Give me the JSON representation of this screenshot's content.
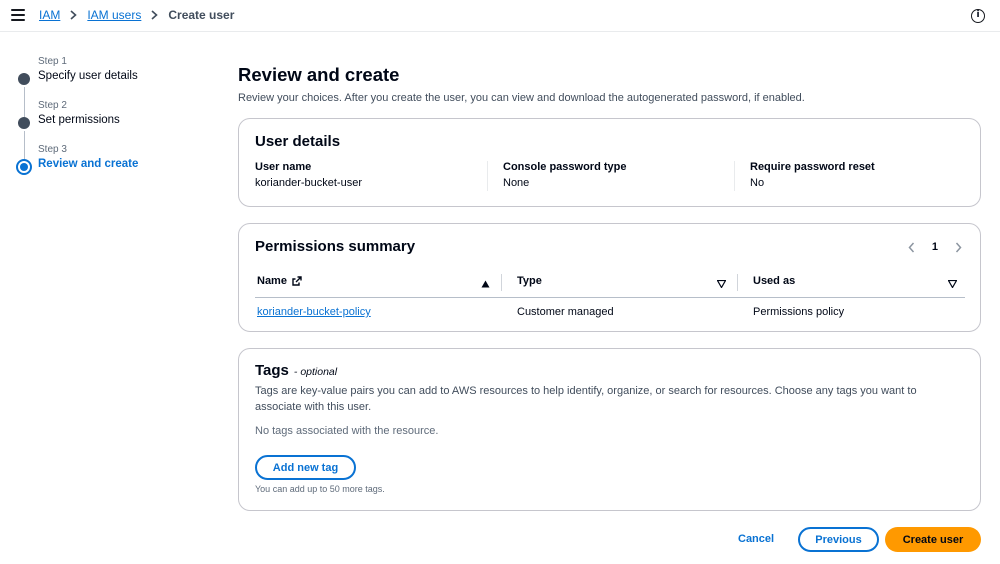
{
  "breadcrumb": {
    "items": [
      "IAM",
      "IAM users"
    ],
    "current": "Create user"
  },
  "steps": [
    {
      "number": "Step 1",
      "title": "Specify user details",
      "state": "completed"
    },
    {
      "number": "Step 2",
      "title": "Set permissions",
      "state": "completed"
    },
    {
      "number": "Step 3",
      "title": "Review and create",
      "state": "active"
    }
  ],
  "page": {
    "title": "Review and create",
    "description": "Review your choices. After you create the user, you can view and download the autogenerated password, if enabled."
  },
  "user_details": {
    "title": "User details",
    "fields": [
      {
        "label": "User name",
        "value": "koriander-bucket-user"
      },
      {
        "label": "Console password type",
        "value": "None"
      },
      {
        "label": "Require password reset",
        "value": "No"
      }
    ]
  },
  "permissions": {
    "title": "Permissions summary",
    "page": "1",
    "columns": [
      "Name",
      "Type",
      "Used as"
    ],
    "rows": [
      {
        "name": "koriander-bucket-policy",
        "type": "Customer managed",
        "used_as": "Permissions policy"
      }
    ]
  },
  "tags": {
    "title": "Tags",
    "optional": "- optional",
    "description": "Tags are key-value pairs you can add to AWS resources to help identify, organize, or search for resources. Choose any tags you want to associate with this user.",
    "empty": "No tags associated with the resource.",
    "add_label": "Add new tag",
    "limit": "You can add up to 50 more tags."
  },
  "actions": {
    "cancel": "Cancel",
    "previous": "Previous",
    "create": "Create user"
  },
  "colors": {
    "link": "#0972d3",
    "primary_button": "#ff9900",
    "text": "#000716"
  },
  "icons": [
    "menu-icon",
    "chevron-right-icon",
    "info-icon",
    "external-link-icon",
    "sort-ascending-icon",
    "sort-descending-icon",
    "chevron-left-icon"
  ]
}
